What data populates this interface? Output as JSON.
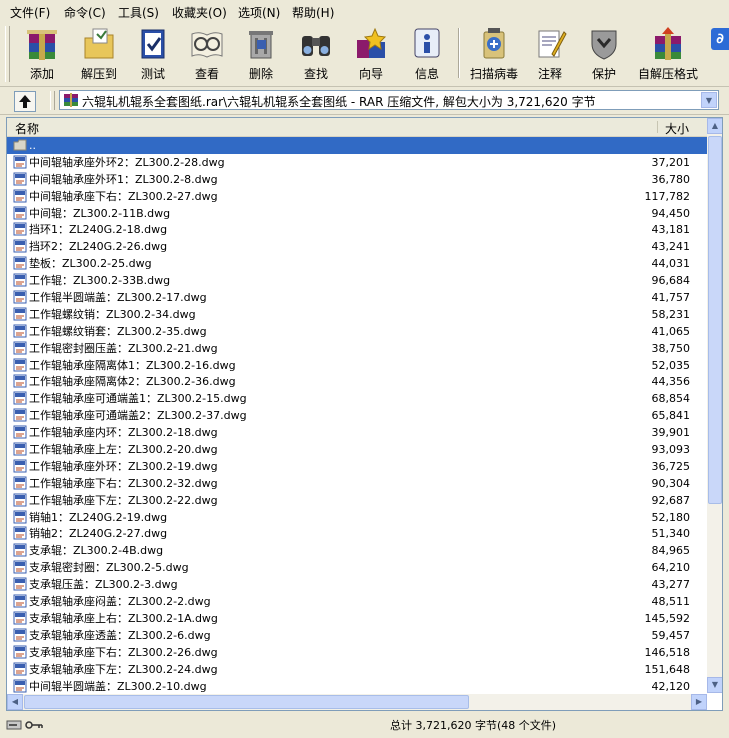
{
  "menu": [
    "文件(F)",
    "命令(C)",
    "工具(S)",
    "收藏夹(O)",
    "选项(N)",
    "帮助(H)"
  ],
  "toolbar": [
    {
      "label": "添加",
      "icon": "add-archive-icon"
    },
    {
      "label": "解压到",
      "icon": "extract-to-icon"
    },
    {
      "label": "测试",
      "icon": "test-icon"
    },
    {
      "label": "查看",
      "icon": "view-icon"
    },
    {
      "label": "删除",
      "icon": "delete-icon"
    },
    {
      "label": "查找",
      "icon": "find-icon"
    },
    {
      "label": "向导",
      "icon": "wizard-icon"
    },
    {
      "label": "信息",
      "icon": "info-icon"
    },
    {
      "label": "扫描病毒",
      "icon": "virus-scan-icon"
    },
    {
      "label": "注释",
      "icon": "comment-icon"
    },
    {
      "label": "保护",
      "icon": "protect-icon"
    },
    {
      "label": "自解压格式",
      "icon": "sfx-icon"
    }
  ],
  "address": {
    "path": "六辊轧机辊系全套图纸.rar\\六辊轧机辊系全套图纸 - RAR 压缩文件, 解包大小为 3,721,620 字节"
  },
  "columns": {
    "name": "名称",
    "size": "大小"
  },
  "files": [
    {
      "name": "..",
      "size": ""
    },
    {
      "name": "中间辊轴承座外环2：ZL300.2-28.dwg",
      "size": "37,201"
    },
    {
      "name": "中间辊轴承座外环1：ZL300.2-8.dwg",
      "size": "36,780"
    },
    {
      "name": "中间辊轴承座下右：ZL300.2-27.dwg",
      "size": "117,782"
    },
    {
      "name": "中间辊：ZL300.2-11B.dwg",
      "size": "94,450"
    },
    {
      "name": "挡环1：ZL240G.2-18.dwg",
      "size": "43,181"
    },
    {
      "name": "挡环2：ZL240G.2-26.dwg",
      "size": "43,241"
    },
    {
      "name": "垫板：ZL300.2-25.dwg",
      "size": "44,031"
    },
    {
      "name": "工作辊：ZL300.2-33B.dwg",
      "size": "96,684"
    },
    {
      "name": "工作辊半圆端盖：ZL300.2-17.dwg",
      "size": "41,757"
    },
    {
      "name": "工作辊螺纹销：ZL300.2-34.dwg",
      "size": "58,231"
    },
    {
      "name": "工作辊螺纹销套：ZL300.2-35.dwg",
      "size": "41,065"
    },
    {
      "name": "工作辊密封圈压盖：ZL300.2-21.dwg",
      "size": "38,750"
    },
    {
      "name": "工作辊轴承座隔离体1：ZL300.2-16.dwg",
      "size": "52,035"
    },
    {
      "name": "工作辊轴承座隔离体2：ZL300.2-36.dwg",
      "size": "44,356"
    },
    {
      "name": "工作辊轴承座可通端盖1：ZL300.2-15.dwg",
      "size": "68,854"
    },
    {
      "name": "工作辊轴承座可通端盖2：ZL300.2-37.dwg",
      "size": "65,841"
    },
    {
      "name": "工作辊轴承座内环：ZL300.2-18.dwg",
      "size": "39,901"
    },
    {
      "name": "工作辊轴承座上左：ZL300.2-20.dwg",
      "size": "93,093"
    },
    {
      "name": "工作辊轴承座外环：ZL300.2-19.dwg",
      "size": "36,725"
    },
    {
      "name": "工作辊轴承座下右：ZL300.2-32.dwg",
      "size": "90,304"
    },
    {
      "name": "工作辊轴承座下左：ZL300.2-22.dwg",
      "size": "92,687"
    },
    {
      "name": "销轴1：ZL240G.2-19.dwg",
      "size": "52,180"
    },
    {
      "name": "销轴2：ZL240G.2-27.dwg",
      "size": "51,340"
    },
    {
      "name": "支承辊：ZL300.2-4B.dwg",
      "size": "84,965"
    },
    {
      "name": "支承辊密封圈：ZL300.2-5.dwg",
      "size": "64,210"
    },
    {
      "name": "支承辊压盖：ZL300.2-3.dwg",
      "size": "43,277"
    },
    {
      "name": "支承辊轴承座闷盖：ZL300.2-2.dwg",
      "size": "48,511"
    },
    {
      "name": "支承辊轴承座上右：ZL300.2-1A.dwg",
      "size": "145,592"
    },
    {
      "name": "支承辊轴承座透盖：ZL300.2-6.dwg",
      "size": "59,457"
    },
    {
      "name": "支承辊轴承座下右：ZL300.2-26.dwg",
      "size": "146,518"
    },
    {
      "name": "支承辊轴承座下左：ZL300.2-24.dwg",
      "size": "151,648"
    },
    {
      "name": "中间辊半圆端盖：ZL300.2-10.dwg",
      "size": "42,120"
    }
  ],
  "status": {
    "text": "总计 3,721,620 字节(48 个文件)"
  },
  "colors": {
    "selection": "#316ac5",
    "window": "#ece9d8"
  }
}
